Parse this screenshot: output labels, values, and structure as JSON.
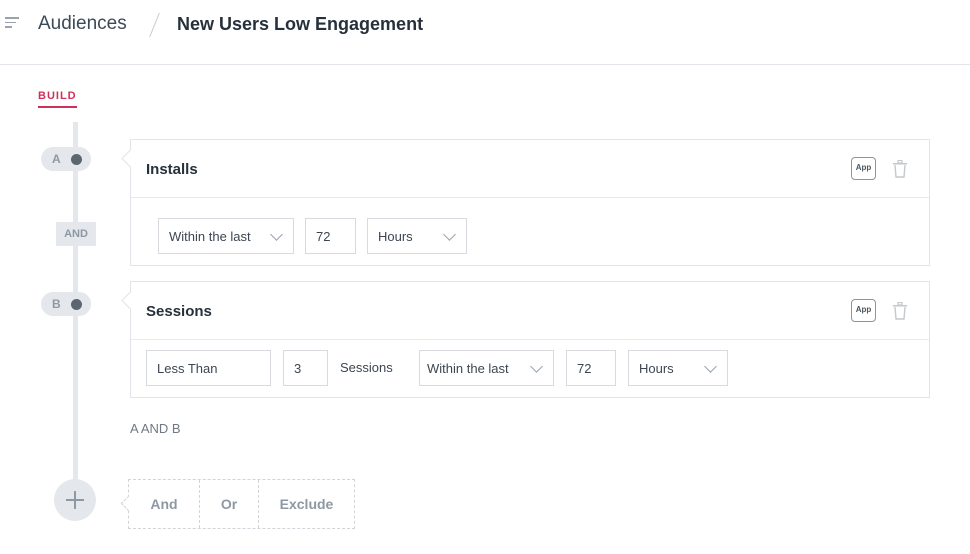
{
  "header": {
    "menu_icon": "menu-icon",
    "breadcrumb_root": "Audiences",
    "title": "New Users Low Engagement"
  },
  "tabs": {
    "build": "BUILD",
    "accent_color": "#d0315a"
  },
  "conditions": [
    {
      "node": "A",
      "title": "Installs",
      "app_badge": "App",
      "time_operator": "Within the last",
      "time_value": "72",
      "time_unit": "Hours"
    },
    {
      "node": "B",
      "title": "Sessions",
      "app_badge": "App",
      "comparison": "Less Than",
      "count": "3",
      "count_unit": "Sessions",
      "time_operator": "Within the last",
      "time_value": "72",
      "time_unit": "Hours"
    }
  ],
  "connector": "AND",
  "logic_expression": "A AND B",
  "add_options": [
    "And",
    "Or",
    "Exclude"
  ]
}
